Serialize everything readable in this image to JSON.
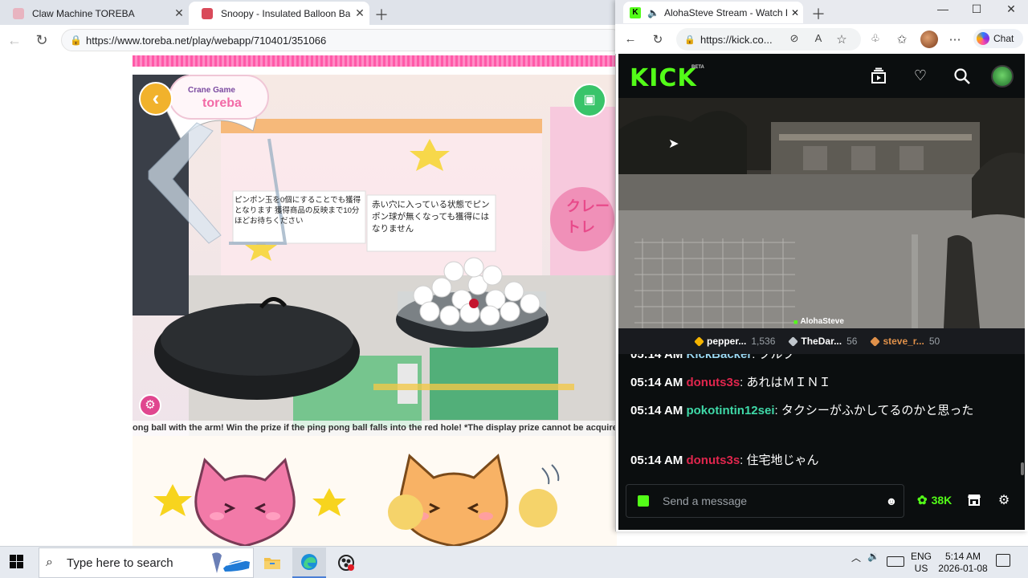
{
  "left_browser": {
    "tabs": [
      {
        "title": "Claw Machine TOREBA",
        "color": "#e8b4c0"
      },
      {
        "title": "Snoopy - Insulated Balloon Bag S",
        "color": "#d94a5a"
      }
    ],
    "url": "https://www.toreba.net/play/webapp/710401/351066",
    "page": {
      "logo_top": "Crane Game",
      "logo_main": "toreba",
      "notice_1": "ピンポン玉を0個にすることでも獲得となります 獲得商品の反映まで10分ほどお待ちください",
      "notice_2": "赤い穴に入っている状態でピンポン球が無くなっても獲得にはなりません",
      "side_sign": "クレー トレ",
      "marquee": "ong ball with the arm! Win the prize if the ping pong ball falls into the red hole! *The display prize cannot be acquired. Ava"
    }
  },
  "right_browser": {
    "tab": {
      "title": "AlohaSteve Stream - Watch L",
      "favicon": "K"
    },
    "url": "https://kick.co...",
    "copilot_label": "Chat"
  },
  "kick": {
    "logo": "KICK",
    "beta": "BETA",
    "streamer": "AlohaSteve",
    "leaderboard": [
      {
        "name": "pepper...",
        "count": "1,536",
        "color": "#f5b400",
        "name_color": "#ffffff"
      },
      {
        "name": "TheDar...",
        "count": "56",
        "color": "#c0c6cc",
        "name_color": "#ffffff"
      },
      {
        "name": "steve_r...",
        "count": "50",
        "color": "#e0914a",
        "name_color": "#e0914a"
      }
    ],
    "messages": [
      {
        "time": "05:14 AM",
        "user": "KickBacker",
        "user_color": "#9ad6f0",
        "text": " ブルブ"
      },
      {
        "time": "05:14 AM",
        "user": "donuts3s",
        "user_color": "#e0264d",
        "text": "あれはＭＩＮＩ"
      },
      {
        "time": "05:14 AM",
        "user": "pokotintin12sei",
        "user_color": "#3fd9a8",
        "text": "タクシーがふかしてるのかと思った"
      },
      {
        "time": "05:14 AM",
        "user": "donuts3s",
        "user_color": "#e0264d",
        "text": "住宅地じゃん"
      }
    ],
    "chat_placeholder": "Send a message",
    "kicks_count": "38K"
  },
  "taskbar": {
    "search_placeholder": "Type here to search",
    "lang_1": "ENG",
    "lang_2": "US",
    "time": "5:14 AM",
    "date": "2026-01-08"
  }
}
